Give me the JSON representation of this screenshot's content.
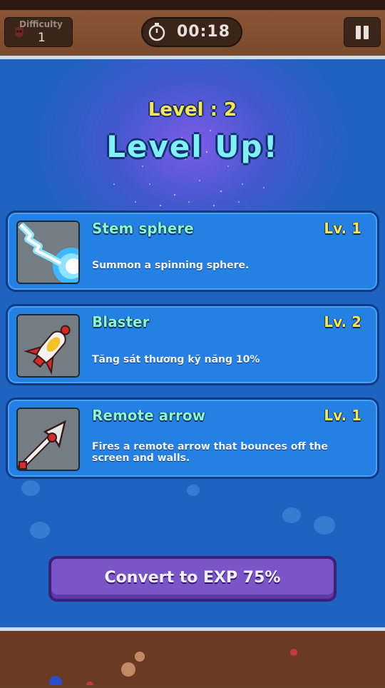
{
  "hud": {
    "difficulty_label": "Difficulty",
    "difficulty_value": "1",
    "timer": "00:18"
  },
  "header": {
    "level": "Level : 2",
    "title": "Level Up!"
  },
  "skills": [
    {
      "name": "Stem sphere",
      "level": "Lv. 1",
      "description": "Summon a spinning sphere.",
      "icon": "lightning-sphere-icon"
    },
    {
      "name": "Blaster",
      "level": "Lv. 2",
      "description": "Tăng sát thương kỹ năng 10%",
      "icon": "rocket-blaster-icon"
    },
    {
      "name": "Remote arrow",
      "level": "Lv. 1",
      "description": "Fires a remote arrow that bounces off the screen and walls.",
      "icon": "arrow-icon"
    }
  ],
  "convert": {
    "label": "Convert to EXP 75%"
  },
  "colors": {
    "panel": "#1e63c0",
    "card": "#2580e4",
    "skill_name": "#8af7c8",
    "level": "#f5e84e",
    "convert_button": "#7a55c8"
  }
}
